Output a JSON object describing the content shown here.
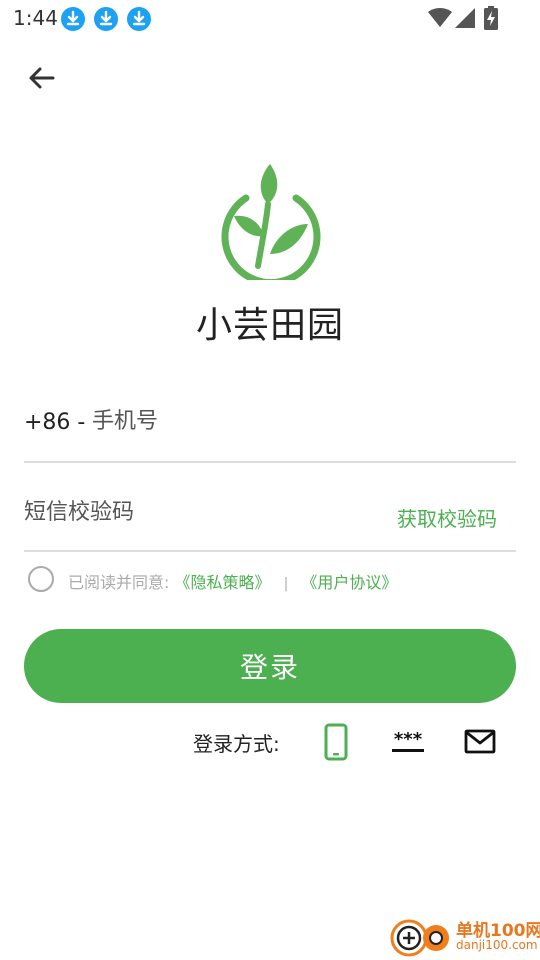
{
  "status_bar": {
    "time": "1:44",
    "notifications": [
      "download-icon",
      "download-icon",
      "download-icon"
    ],
    "system_icons": [
      "wifi-icon",
      "signal-icon",
      "battery-charging-icon"
    ]
  },
  "header": {
    "back_icon": "arrow-left-icon"
  },
  "brand": {
    "logo_icon": "sprout-leaf-logo",
    "app_name": "小芸田园"
  },
  "form": {
    "country_code": "+86 -",
    "phone_placeholder": "手机号",
    "code_placeholder": "短信校验码",
    "get_code_label": "获取校验码"
  },
  "agreement": {
    "prefix": "已阅读并同意:",
    "privacy_link": "《隐私策略》",
    "separator": "|",
    "user_link": "《用户协议》"
  },
  "login_button_label": "登录",
  "login_methods": {
    "label": "登录方式:",
    "options": [
      {
        "name": "phone-icon",
        "active": true
      },
      {
        "name": "password-icon",
        "text": "***",
        "active": false
      },
      {
        "name": "email-icon",
        "active": false
      }
    ]
  },
  "watermark": {
    "cn": "单机100网",
    "en": "danji100.com"
  },
  "colors": {
    "accent": "#4caf50",
    "notification_blue": "#1da1f2",
    "text_primary": "#222222",
    "text_muted": "#aaaaaa",
    "divider": "#dddddd",
    "watermark_orange": "#e8771e"
  }
}
